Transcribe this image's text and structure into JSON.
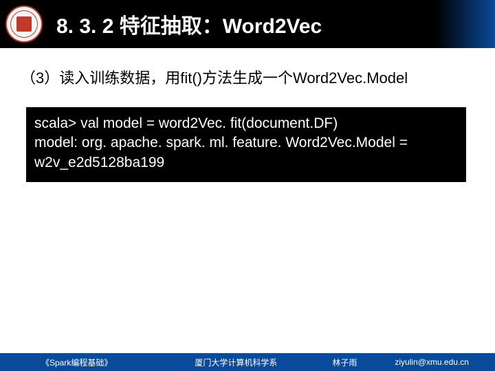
{
  "header": {
    "title": "8. 3. 2 特征抽取：Word2Vec"
  },
  "content": {
    "step": "（3）读入训练数据，用fit()方法生成一个Word2Vec.Model",
    "code_line1": "scala> val model = word2Vec. fit(document.DF)",
    "code_line2": "model: org. apache. spark. ml. feature. Word2Vec.Model =",
    "code_line3": "w2v_e2d5128ba199"
  },
  "footer": {
    "book": "《Spark编程基础》",
    "dept": "厦门大学计算机科学系",
    "author": "林子雨",
    "email": "ziyulin@xmu.edu.cn"
  }
}
